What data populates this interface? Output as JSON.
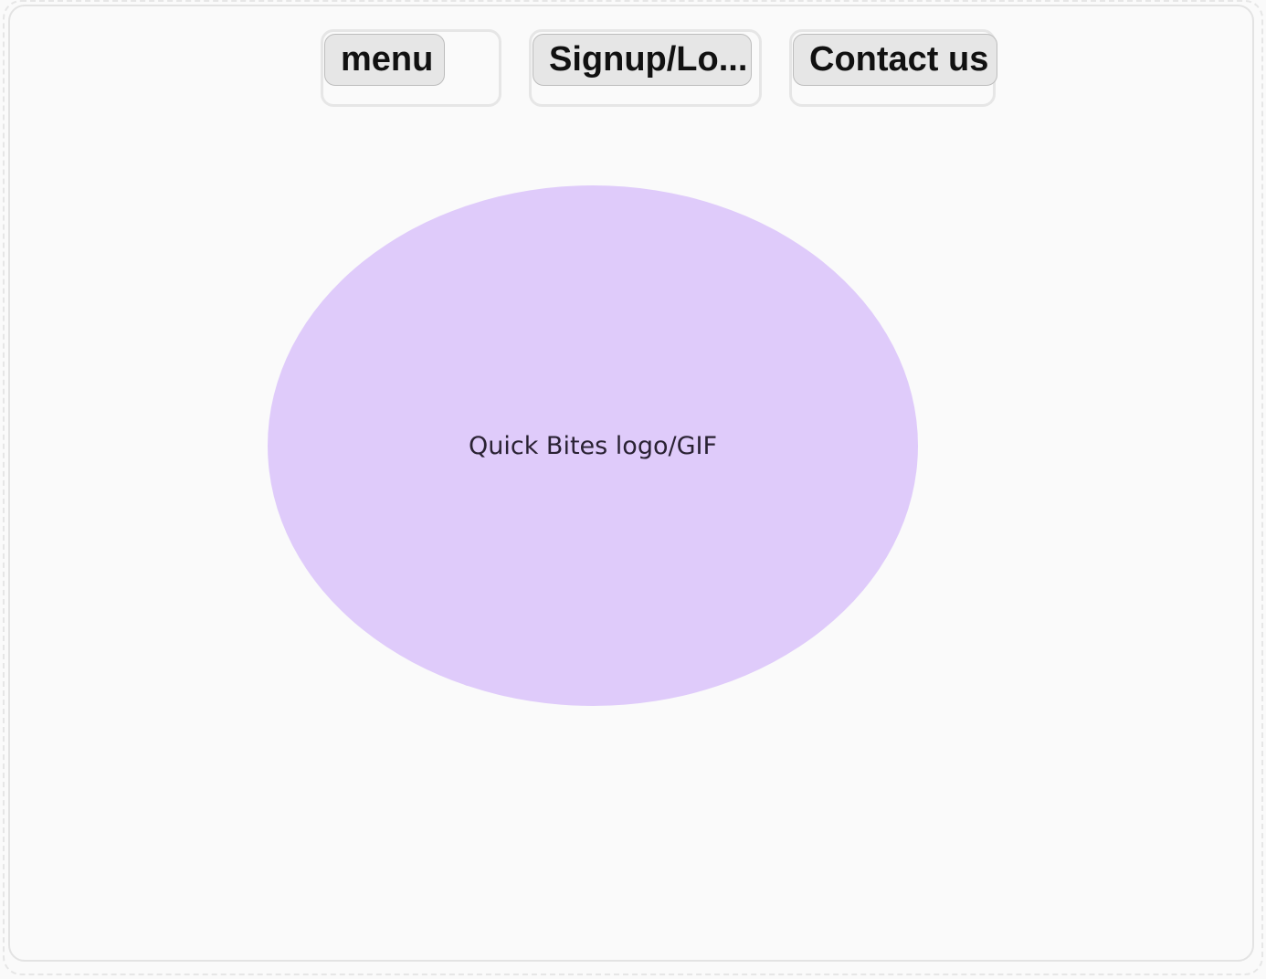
{
  "nav": {
    "menu_label": "menu",
    "signup_label": "Signup/Lo...",
    "contact_label": "Contact us"
  },
  "hero": {
    "logo_placeholder": "Quick Bites logo/GIF",
    "logo_color": "#dfcbfa"
  }
}
